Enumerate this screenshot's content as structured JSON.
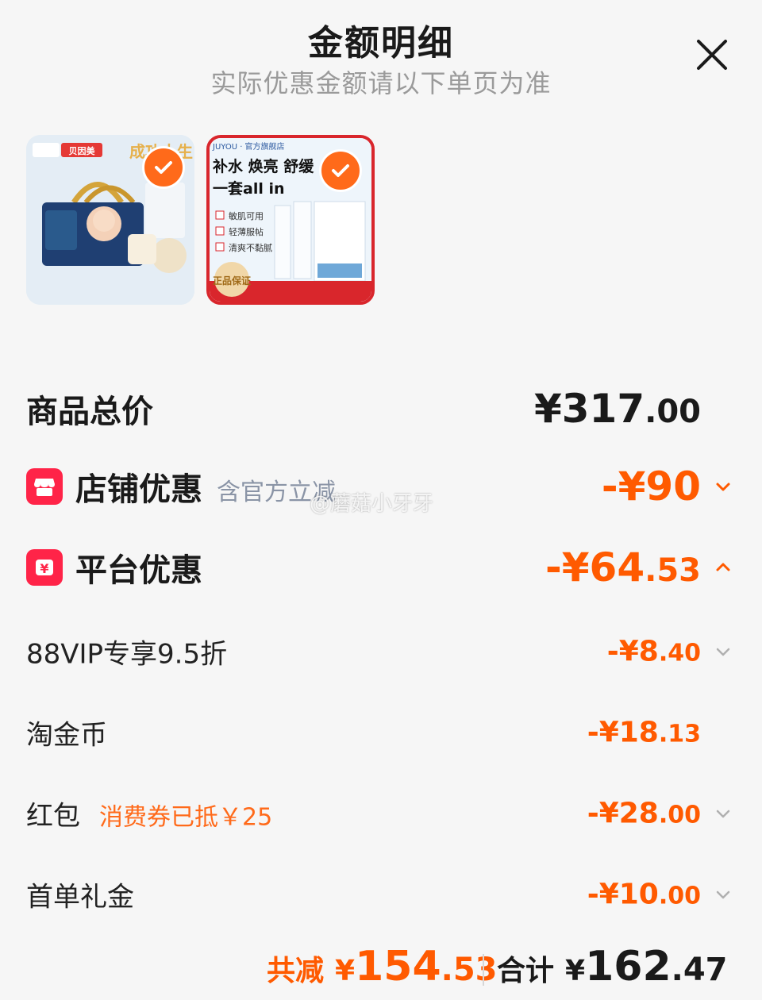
{
  "header": {
    "title": "金额明细",
    "subtitle": "实际优惠金额请以下单页为准"
  },
  "products": [
    {
      "brand": "贝因美",
      "slogan": "成功人生",
      "selected": true
    },
    {
      "brand": "JUYOU · 官方旗舰店",
      "headline_1": "补水 焕亮 舒缓",
      "headline_2": "一套all in",
      "features": [
        "敏肌可用",
        "轻薄服帖",
        "清爽不黏腻"
      ],
      "badge": "正品保证",
      "selected": true
    }
  ],
  "summary": {
    "subtotal_label": "商品总价",
    "subtotal_currency": "¥",
    "subtotal_int": "317",
    "subtotal_cents": ".00",
    "store_discount_label": "店铺优惠",
    "store_discount_note": "含官方立减",
    "store_discount_amount": "-¥90",
    "platform_discount_label": "平台优惠",
    "platform_discount_int": "-¥64",
    "platform_discount_cents": ".53"
  },
  "platform_items": [
    {
      "label": "88VIP专享9.5折",
      "amount_int": "-¥8",
      "amount_cents": ".40",
      "note": ""
    },
    {
      "label": "淘金币",
      "amount_int": "-¥18",
      "amount_cents": ".13",
      "note": ""
    },
    {
      "label": "红包",
      "amount_int": "-¥28",
      "amount_cents": ".00",
      "note": "消费券已抵￥25"
    },
    {
      "label": "首单礼金",
      "amount_int": "-¥10",
      "amount_cents": ".00",
      "note": ""
    }
  ],
  "footer": {
    "saved_label": "共减",
    "saved_currency": "¥",
    "saved_int": "154",
    "saved_cents": ".53",
    "total_label": "合计",
    "total_currency": "¥",
    "total_int": "162",
    "total_cents": ".47"
  },
  "watermark": "@蘑菇小牙牙",
  "colors": {
    "accent": "#ff5a00",
    "check": "#ff6a1a",
    "icon_red": "#ff2448",
    "note_gray": "#8a94a6"
  }
}
